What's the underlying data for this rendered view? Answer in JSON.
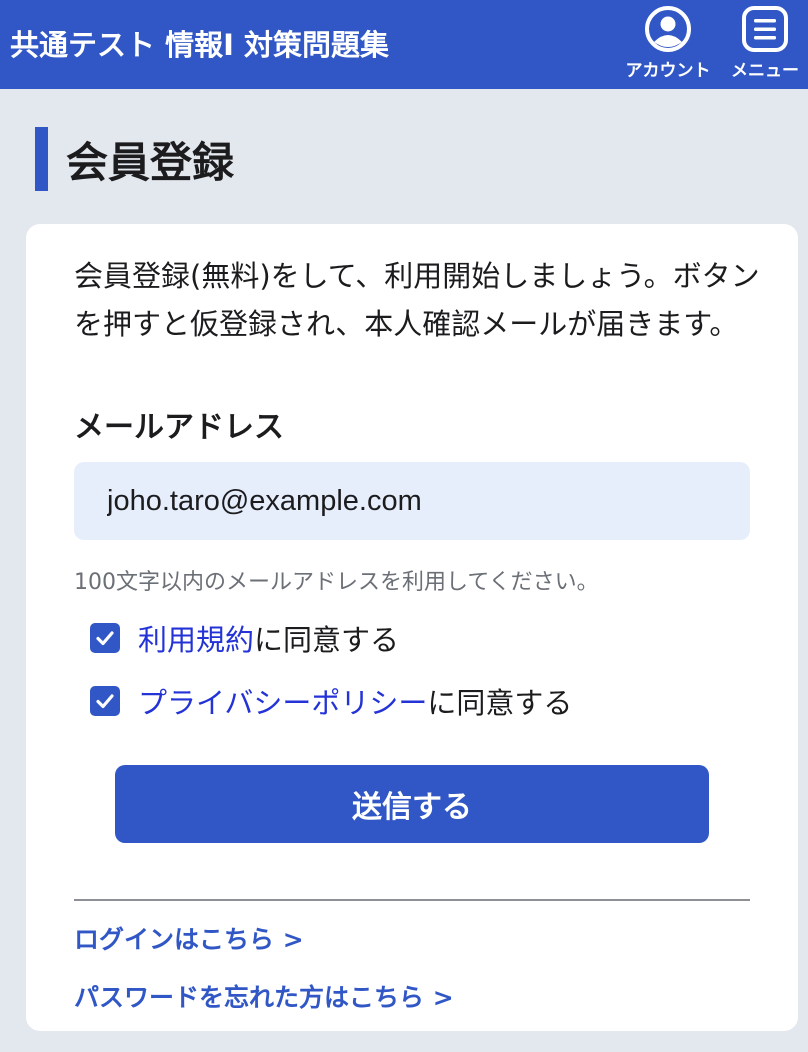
{
  "header": {
    "title": "共通テスト 情報I 対策問題集",
    "account_label": "アカウント",
    "menu_label": "メニュー"
  },
  "page": {
    "heading": "会員登録"
  },
  "form": {
    "intro": "会員登録(無料)をして、利用開始しましょう。ボタンを押すと仮登録され、本人確認メールが届きます。",
    "email_label": "メールアドレス",
    "email_value": "joho.taro@example.com",
    "email_hint": "100文字以内のメールアドレスを利用してください。",
    "terms_link": "利用規約",
    "terms_suffix": "に同意する",
    "terms_checked": true,
    "privacy_link": "プライバシーポリシー",
    "privacy_suffix": "に同意する",
    "privacy_checked": true,
    "submit_label": "送信する"
  },
  "footer_links": {
    "login": "ログインはこちら >",
    "forgot_password": "パスワードを忘れた方はこちら >"
  },
  "colors": {
    "brand": "#3057c5",
    "link": "#2433d6",
    "background": "#e3e7ee",
    "input_bg": "#e7eefb"
  }
}
